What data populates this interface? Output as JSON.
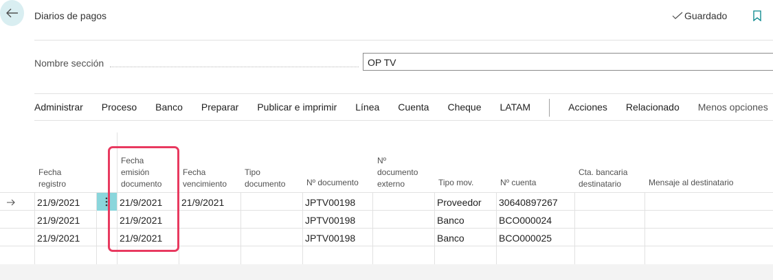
{
  "header": {
    "title": "Diarios de pagos",
    "status": "Guardado"
  },
  "section": {
    "label": "Nombre sección",
    "value": "OP TV"
  },
  "actions": {
    "items": [
      "Administrar",
      "Proceso",
      "Banco",
      "Preparar",
      "Publicar e imprimir",
      "Línea",
      "Cuenta",
      "Cheque",
      "LATAM"
    ],
    "secondary": [
      "Acciones",
      "Relacionado"
    ],
    "less": "Menos opciones"
  },
  "columns": {
    "fecha_registro": [
      "Fecha",
      "registro"
    ],
    "fecha_emision": [
      "Fecha",
      "emisión",
      "documento"
    ],
    "fecha_vencimiento": [
      "Fecha",
      "vencimiento"
    ],
    "tipo_documento": [
      "Tipo",
      "documento"
    ],
    "no_documento": "Nº documento",
    "no_doc_externo": [
      "Nº",
      "documento",
      "externo"
    ],
    "tipo_mov": "Tipo mov.",
    "no_cuenta": "Nº cuenta",
    "cta_bancaria": [
      "Cta. bancaria",
      "destinatario"
    ],
    "mensaje": "Mensaje al destinatario"
  },
  "rows": [
    {
      "fecha_registro": "21/9/2021",
      "fecha_emision": "21/9/2021",
      "fecha_vencimiento": "21/9/2021",
      "no_documento": "JPTV00198",
      "tipo_mov": "Proveedor",
      "no_cuenta": "30640897267"
    },
    {
      "fecha_registro": "21/9/2021",
      "fecha_emision": "21/9/2021",
      "fecha_vencimiento": "",
      "no_documento": "JPTV00198",
      "tipo_mov": "Banco",
      "no_cuenta": "BCO000024"
    },
    {
      "fecha_registro": "21/9/2021",
      "fecha_emision": "21/9/2021",
      "fecha_vencimiento": "",
      "no_documento": "JPTV00198",
      "tipo_mov": "Banco",
      "no_cuenta": "BCO000025"
    }
  ],
  "colors": {
    "accent": "#008489",
    "back_bg": "#d9eef1",
    "selected_cell": "#8ad6dc",
    "highlight": "#e8395f"
  }
}
